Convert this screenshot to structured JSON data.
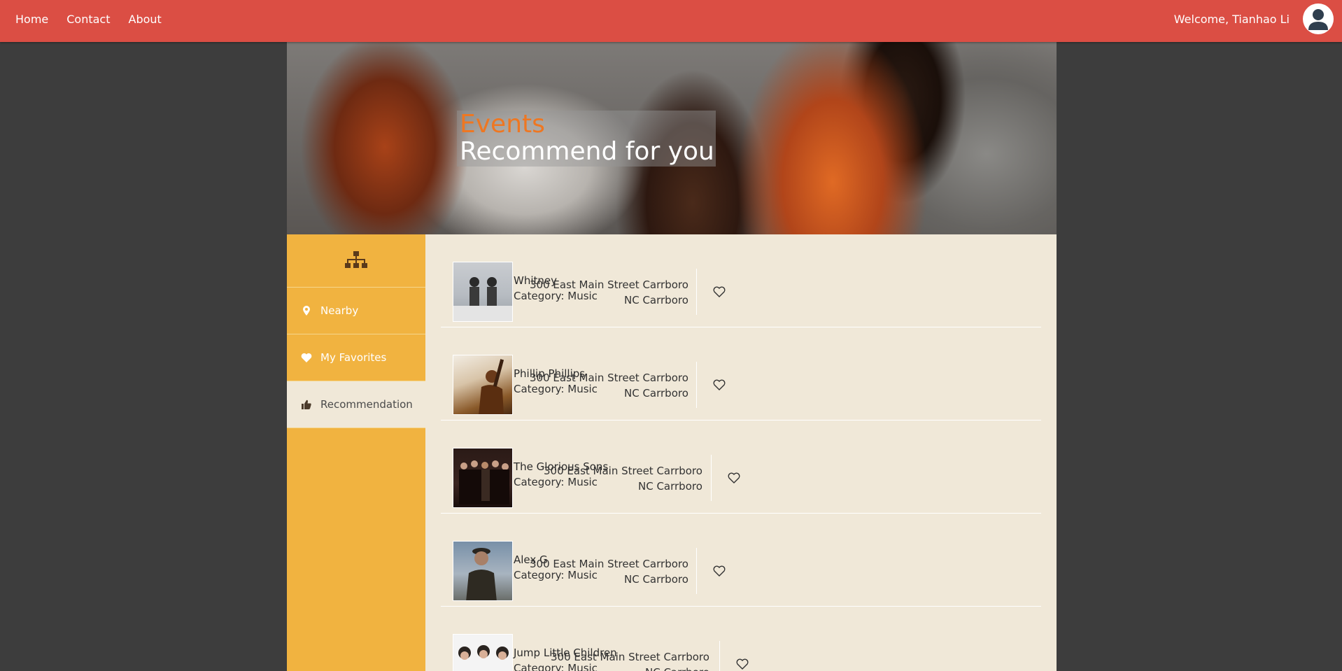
{
  "nav": {
    "home": "Home",
    "contact": "Contact",
    "about": "About"
  },
  "user": {
    "welcome": "Welcome, Tianhao Li"
  },
  "hero": {
    "line1": "Events",
    "line2": "Recommend for you"
  },
  "sidebar": {
    "items": [
      {
        "label": "Nearby",
        "icon": "map-pin-icon"
      },
      {
        "label": "My Favorites",
        "icon": "heart-icon"
      },
      {
        "label": "Recommendation",
        "icon": "thumbs-up-icon"
      }
    ]
  },
  "events": [
    {
      "name": "Whitney",
      "category": "Category: Music",
      "addr1": "300 East Main Street Carrboro",
      "addr2": "NC Carrboro"
    },
    {
      "name": "Phillip Phillips",
      "category": "Category: Music",
      "addr1": "300 East Main Street Carrboro",
      "addr2": "NC Carrboro"
    },
    {
      "name": "The Glorious Sons",
      "category": "Category: Music",
      "addr1": "300 East Main Street Carrboro",
      "addr2": "NC Carrboro"
    },
    {
      "name": "Alex G",
      "category": "Category: Music",
      "addr1": "300 East Main Street Carrboro",
      "addr2": "NC Carrboro"
    },
    {
      "name": "Jump Little Children",
      "category": "Category: Music",
      "addr1": "300 East Main Street Carrboro",
      "addr2": "NC Carrboro"
    }
  ],
  "colors": {
    "topbar": "#db4e44",
    "sidebar": "#f1b340",
    "content": "#f0e8d8",
    "accent": "#ee7722"
  }
}
